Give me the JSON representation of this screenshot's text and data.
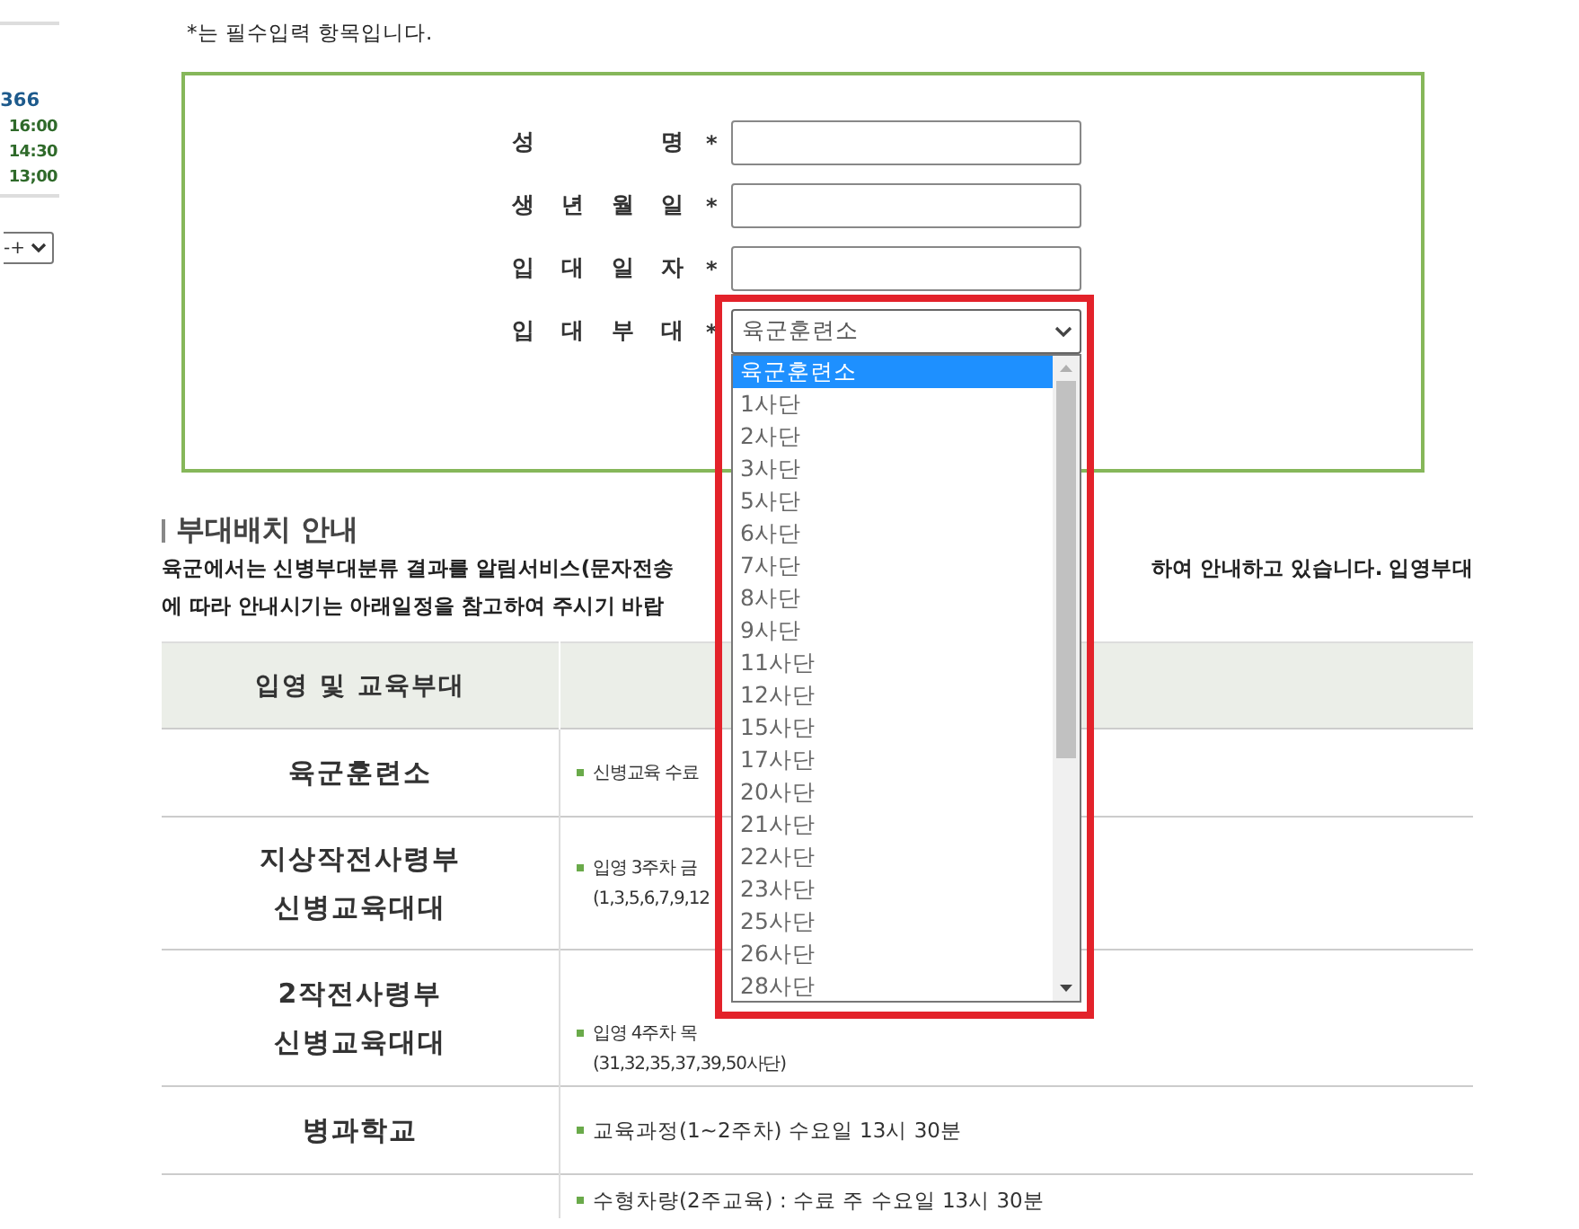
{
  "sidebar": {
    "count": "366",
    "times": [
      "16:00",
      "14:30",
      "13;00"
    ],
    "select": {
      "value": "-+"
    }
  },
  "form": {
    "note": "*는 필수입력 항목입니다.",
    "fields": [
      {
        "kind": "text",
        "label": "성 명",
        "required_mark": "*"
      },
      {
        "kind": "text",
        "label": "생 년 월 일",
        "required_mark": "*"
      },
      {
        "kind": "text",
        "label": "입 대 일 자",
        "required_mark": "*"
      },
      {
        "kind": "select",
        "label": "입 대 부 대",
        "required_mark": "*",
        "value": "육군훈련소",
        "expanded": true,
        "highlighted": true,
        "options": [
          {
            "label": "육군훈련소",
            "selected": true
          },
          {
            "label": "1사단",
            "selected": false
          },
          {
            "label": "2사단",
            "selected": false
          },
          {
            "label": "3사단",
            "selected": false
          },
          {
            "label": "5사단",
            "selected": false
          },
          {
            "label": "6사단",
            "selected": false
          },
          {
            "label": "7사단",
            "selected": false
          },
          {
            "label": "8사단",
            "selected": false
          },
          {
            "label": "9사단",
            "selected": false
          },
          {
            "label": "11사단",
            "selected": false
          },
          {
            "label": "12사단",
            "selected": false
          },
          {
            "label": "15사단",
            "selected": false
          },
          {
            "label": "17사단",
            "selected": false
          },
          {
            "label": "20사단",
            "selected": false
          },
          {
            "label": "21사단",
            "selected": false
          },
          {
            "label": "22사단",
            "selected": false
          },
          {
            "label": "23사단",
            "selected": false
          },
          {
            "label": "25사단",
            "selected": false
          },
          {
            "label": "26사단",
            "selected": false
          },
          {
            "label": "28사단",
            "selected": false
          }
        ]
      }
    ]
  },
  "section": {
    "title": "부대배치 안내",
    "intro": [
      {
        "left": "육군에서는 신병부대분류 결과를 알림서비스(문자전송",
        "right": "하여 안내하고 있습니다. 입영부대"
      },
      {
        "left": "에 따라 안내시기는 아래일정을 참고하여 주시기 바랍"
      }
    ]
  },
  "table": {
    "columns": [
      "입영 및 교육부대"
    ],
    "rows": [
      {
        "unit": [
          "육군훈련소"
        ],
        "details": [
          {
            "lines": [
              "신병교육 수료"
            ]
          }
        ]
      },
      {
        "unit": [
          "지상작전사령부",
          "신병교육대대"
        ],
        "details": [
          {
            "lines": [
              "입영 3주차 금",
              "(1,3,5,6,7,9,12"
            ]
          }
        ]
      },
      {
        "unit": [
          "2작전사령부",
          "신병교육대대"
        ],
        "details": [
          {
            "lines": [
              "입영 4주차 목",
              "(31,32,35,37,39,50사단)"
            ]
          }
        ]
      },
      {
        "unit": [
          "병과학교"
        ],
        "details": [
          {
            "lines": [
              "교육과정(1~2주차) 수요일 13시 30분"
            ]
          }
        ]
      },
      {
        "details": [
          {
            "lines": [
              "수형차량(2주교육) : 수료 주 수요일 13시 30분"
            ]
          }
        ]
      }
    ]
  }
}
